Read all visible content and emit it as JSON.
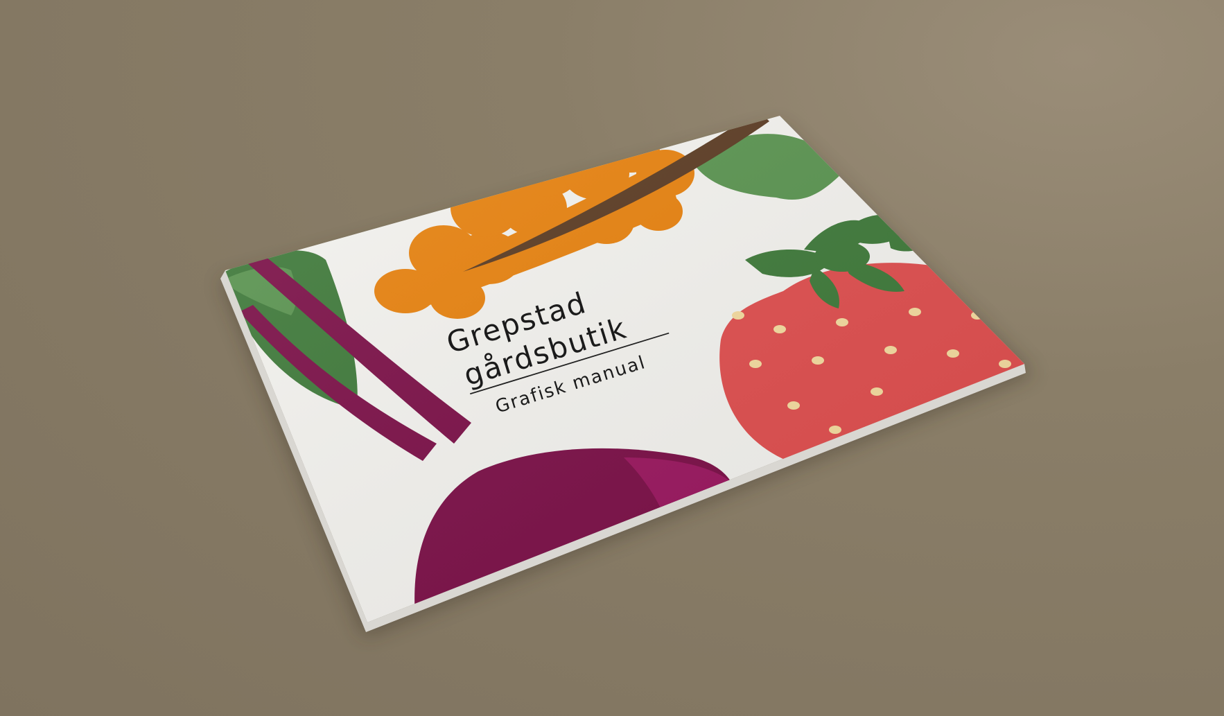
{
  "booklet": {
    "title_line1": "Grepstad",
    "title_line2": "gårdsbutik",
    "subtitle": "Grafisk manual"
  },
  "colors": {
    "background": "#887c66",
    "cover": "#f4f3ef",
    "beetroot": "#7c1048",
    "beetroot_highlight": "#9b1860",
    "carrot": "#e8820e",
    "leaf": "#5a9450",
    "leaf_dark": "#3f7a3a",
    "strawberry": "#e04f4f",
    "seed": "#f5dca0",
    "stem": "#5b3b22"
  },
  "icons": [
    "beetroot-illustration",
    "carrot-illustration",
    "strawberry-illustration",
    "leaf-illustration"
  ]
}
